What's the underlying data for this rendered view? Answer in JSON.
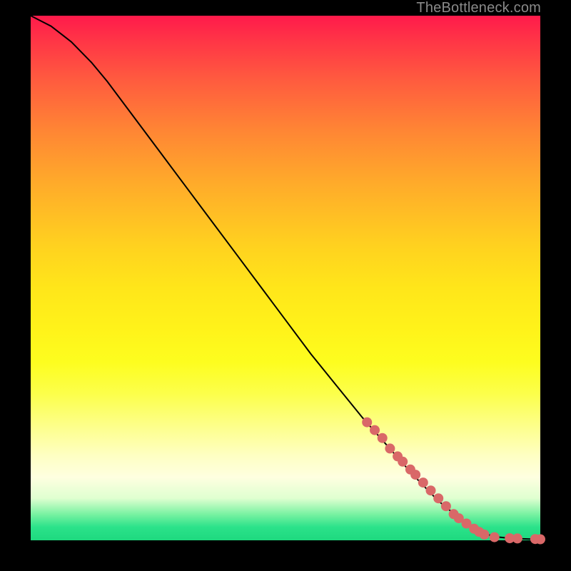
{
  "attribution": "TheBottleneck.com",
  "colors": {
    "line": "#000000",
    "marker": "#d96868",
    "frame": "#000000"
  },
  "chart_data": {
    "type": "line",
    "title": "",
    "xlabel": "",
    "ylabel": "",
    "xlim": [
      0,
      100
    ],
    "ylim": [
      0,
      100
    ],
    "series": [
      {
        "name": "curve",
        "x": [
          0,
          2,
          4,
          6,
          8,
          10,
          12,
          15,
          20,
          25,
          30,
          35,
          40,
          45,
          50,
          55,
          60,
          65,
          70,
          75,
          80,
          85,
          90,
          92,
          94,
          96,
          98,
          100
        ],
        "y": [
          100,
          99,
          98,
          96.5,
          95,
          93,
          91,
          87.5,
          81,
          74.5,
          68,
          61.5,
          55,
          48.5,
          42,
          35.5,
          29.5,
          23.5,
          18,
          12.5,
          7.5,
          3.5,
          1,
          0.6,
          0.4,
          0.3,
          0.25,
          0.2
        ]
      }
    ],
    "markers": {
      "name": "highlight-points",
      "x": [
        66,
        67.5,
        69,
        70.5,
        72,
        73,
        74.5,
        75.5,
        77,
        78.5,
        80,
        81.5,
        83,
        84,
        85.5,
        87,
        88,
        89,
        91,
        94,
        95.5,
        99,
        100
      ],
      "y": [
        22.5,
        21,
        19.5,
        17.5,
        16,
        15,
        13.5,
        12.5,
        11,
        9.5,
        8,
        6.5,
        5,
        4.2,
        3.2,
        2.2,
        1.6,
        1.1,
        0.6,
        0.4,
        0.35,
        0.25,
        0.2
      ],
      "radius_px": 7
    }
  }
}
